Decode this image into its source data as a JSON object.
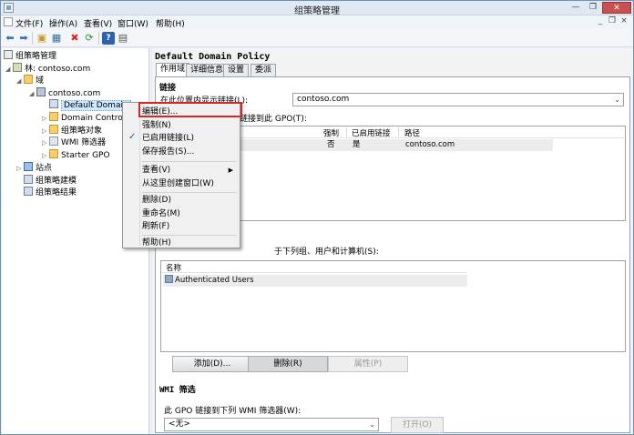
{
  "window": {
    "title": "组策略管理"
  },
  "menubar": {
    "items": [
      "文件(F)",
      "操作(A)",
      "查看(V)",
      "窗口(W)",
      "帮助(H)"
    ]
  },
  "toolbar": {
    "icons": [
      "back-arrow-icon",
      "forward-arrow-icon",
      "folder-up-icon",
      "tree-view-icon",
      "delete-icon",
      "refresh-icon",
      "help-icon",
      "properties-icon"
    ]
  },
  "tree": {
    "root": "组策略管理",
    "forest": "林: contoso.com",
    "domains": "域",
    "domain": "contoso.com",
    "items": [
      "Default Domain",
      "Domain Contro",
      "组策略对象",
      "WMI 筛选器",
      "Starter GPO"
    ],
    "sites": "站点",
    "modeling": "组策略建模",
    "results": "组策略结果"
  },
  "main": {
    "policy_title": "Default Domain Policy",
    "tabs": [
      "作用域",
      "详细信息",
      "设置",
      "委派"
    ],
    "links_head": "链接",
    "links_location_label": "在此位置内显示链接(L):",
    "links_location_value": "contoso.com",
    "links_desc": "链接到此 GPO(T):",
    "links_columns": [
      "强制",
      "已启用链接",
      "路径"
    ],
    "links_rows": [
      {
        "enforced": "否",
        "enabled": "是",
        "path": "contoso.com"
      }
    ],
    "security_label_visible": "于下列组、用户和计算机(S):",
    "security_column": "名称",
    "security_rows": [
      "Authenticated Users"
    ],
    "buttons": {
      "add": "添加(D)...",
      "remove": "删除(R)",
      "properties": "属性(P)"
    },
    "wmi_head": "WMI 筛选",
    "wmi_label": "此 GPO 链接到下列 WMI 筛选器(W):",
    "wmi_value": "<无>",
    "wmi_open": "打开(O)"
  },
  "context_menu": {
    "items": [
      "编辑(E)...",
      "强制(N)",
      "已启用链接(L)",
      "保存报告(S)...",
      "查看(V)",
      "从这里创建窗口(W)",
      "删除(D)",
      "重命名(M)",
      "刷新(F)",
      "帮助(H)"
    ],
    "checked": "已启用链接(L)"
  },
  "colors": {
    "selection": "#cde8ff",
    "highlight_box": "#d02828",
    "close_button": "#c75050"
  }
}
